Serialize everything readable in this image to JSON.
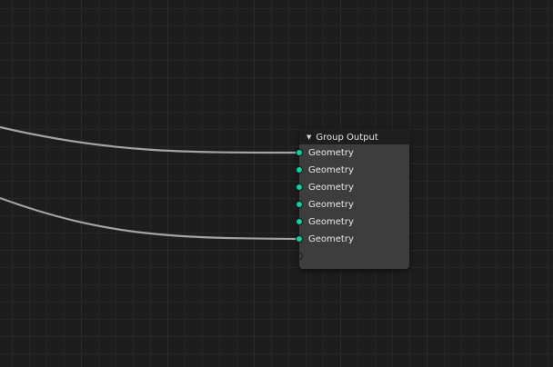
{
  "node": {
    "title": "Group Output",
    "collapse_icon": "triangle-down-icon",
    "inputs": [
      {
        "label": "Geometry"
      },
      {
        "label": "Geometry"
      },
      {
        "label": "Geometry"
      },
      {
        "label": "Geometry"
      },
      {
        "label": "Geometry"
      },
      {
        "label": "Geometry"
      }
    ]
  },
  "colors": {
    "geometry_socket": "#00d6a3",
    "link": "#a0a0a0",
    "canvas": "#1d1d1d",
    "node_body": "#3d3d3d",
    "node_header": "#1e1e1e"
  }
}
